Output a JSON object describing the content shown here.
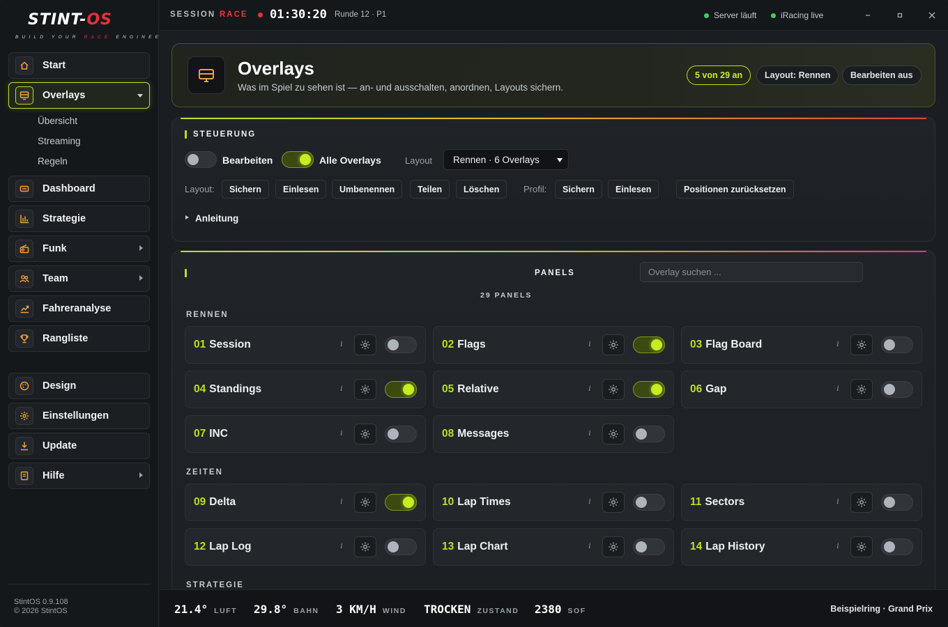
{
  "brand": {
    "name_part1": "STINT-",
    "name_part2": "OS",
    "tagline_part1": "BUILD YOUR ",
    "tagline_part2": "RACE",
    "tagline_part3": " ENGINEER."
  },
  "sidebar": {
    "items": [
      {
        "label": "Start",
        "icon": "home-icon"
      },
      {
        "label": "Overlays",
        "icon": "monitor-icon"
      },
      {
        "label": "Dashboard",
        "icon": "dashboard-icon"
      },
      {
        "label": "Strategie",
        "icon": "bar-chart-icon"
      },
      {
        "label": "Funk",
        "icon": "radio-icon"
      },
      {
        "label": "Team",
        "icon": "team-icon"
      },
      {
        "label": "Fahreranalyse",
        "icon": "trend-icon"
      },
      {
        "label": "Rangliste",
        "icon": "trophy-icon"
      },
      {
        "label": "Design",
        "icon": "palette-icon"
      },
      {
        "label": "Einstellungen",
        "icon": "gear-icon"
      },
      {
        "label": "Update",
        "icon": "download-icon"
      },
      {
        "label": "Hilfe",
        "icon": "book-icon"
      }
    ],
    "subitems": [
      "Übersicht",
      "Streaming",
      "Regeln"
    ],
    "version": "StintOS 0.9.108",
    "copyright": "© 2026 StintOS"
  },
  "topbar": {
    "session_label": "SESSION",
    "session_type": "RACE",
    "time": "01:30:20",
    "round": "Runde 12 · P1",
    "status1": "Server läuft",
    "status2": "iRacing live"
  },
  "hero": {
    "title": "Overlays",
    "subtitle": "Was im Spiel zu sehen ist — an- und ausschalten, anordnen, Layouts sichern.",
    "badge": "5 von 29 an",
    "layout": "Layout: Rennen",
    "edit": "Bearbeiten aus"
  },
  "control": {
    "title": "STEUERUNG",
    "edit_label": "Bearbeiten",
    "all_label": "Alle Overlays",
    "layout_label": "Layout",
    "layout_value": "Rennen · 6 Overlays",
    "layout_prefix": "Layout:",
    "layout_buttons": [
      "Sichern",
      "Einlesen",
      "Umbenennen",
      "Teilen",
      "Löschen"
    ],
    "profile_prefix": "Profil:",
    "profile_buttons": [
      "Sichern",
      "Einlesen"
    ],
    "reset": "Positionen zurücksetzen",
    "guide": "Anleitung"
  },
  "panels": {
    "title": "PANELS",
    "count": "29 PANELS",
    "search_placeholder": "Overlay suchen ...",
    "groups": [
      "RENNEN",
      "ZEITEN",
      "STRATEGIE"
    ],
    "items": [
      {
        "num": "01",
        "name": "Session",
        "on": false
      },
      {
        "num": "02",
        "name": "Flags",
        "on": true
      },
      {
        "num": "03",
        "name": "Flag Board",
        "on": false
      },
      {
        "num": "04",
        "name": "Standings",
        "on": true
      },
      {
        "num": "05",
        "name": "Relative",
        "on": true
      },
      {
        "num": "06",
        "name": "Gap",
        "on": false
      },
      {
        "num": "07",
        "name": "INC",
        "on": false
      },
      {
        "num": "08",
        "name": "Messages",
        "on": false
      },
      {
        "num": "09",
        "name": "Delta",
        "on": true
      },
      {
        "num": "10",
        "name": "Lap Times",
        "on": false
      },
      {
        "num": "11",
        "name": "Sectors",
        "on": false
      },
      {
        "num": "12",
        "name": "Lap Log",
        "on": false
      },
      {
        "num": "13",
        "name": "Lap Chart",
        "on": false
      },
      {
        "num": "14",
        "name": "Lap History",
        "on": false
      }
    ],
    "info_glyph": "i"
  },
  "bottombar": {
    "metrics": [
      {
        "value": "21.4°",
        "unit": "LUFT"
      },
      {
        "value": "29.8°",
        "unit": "BAHN"
      },
      {
        "value": "3 KM/H",
        "unit": "WIND"
      },
      {
        "value": "TROCKEN",
        "unit": "ZUSTAND"
      },
      {
        "value": "2380",
        "unit": "SOF"
      }
    ],
    "track": "Beispielring · Grand Prix"
  },
  "colors": {
    "accent": "#b9e021",
    "race": "#e8313a",
    "status_ok": "#3fcf5a"
  }
}
